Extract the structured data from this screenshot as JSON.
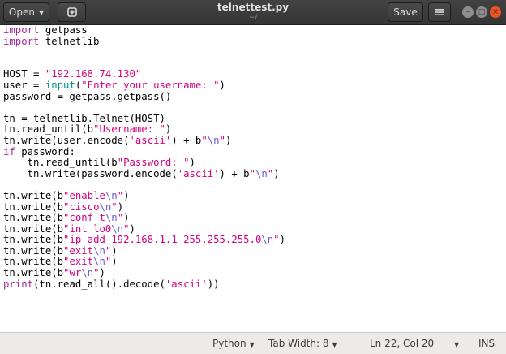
{
  "titlebar": {
    "open_label": "Open",
    "new_tab_icon": "new-tab-icon",
    "title": "telnettest.py",
    "subtitle": "~/",
    "save_label": "Save",
    "menu_icon": "hamburger-menu-icon",
    "minimize_icon": "minimize-icon",
    "maximize_icon": "maximize-icon",
    "close_icon": "close-icon"
  },
  "editor": {
    "lines": [
      [
        {
          "t": "import",
          "c": "kw"
        },
        {
          "t": " getpass"
        }
      ],
      [
        {
          "t": "import",
          "c": "kw"
        },
        {
          "t": " telnetlib"
        }
      ],
      [],
      [],
      [
        {
          "t": "HOST = "
        },
        {
          "t": "\"192.168.74.130\"",
          "c": "str"
        }
      ],
      [
        {
          "t": "user = "
        },
        {
          "t": "input",
          "c": "fn"
        },
        {
          "t": "("
        },
        {
          "t": "\"Enter your username: \"",
          "c": "str"
        },
        {
          "t": ")"
        }
      ],
      [
        {
          "t": "password = getpass.getpass()"
        }
      ],
      [],
      [
        {
          "t": "tn = telnetlib.Telnet(HOST)"
        }
      ],
      [
        {
          "t": "tn.read_until(b"
        },
        {
          "t": "\"Username: \"",
          "c": "str"
        },
        {
          "t": ")"
        }
      ],
      [
        {
          "t": "tn.write(user.encode("
        },
        {
          "t": "'ascii'",
          "c": "str"
        },
        {
          "t": ") + b"
        },
        {
          "t": "\"",
          "c": "str"
        },
        {
          "t": "\\n",
          "c": "esc"
        },
        {
          "t": "\"",
          "c": "str"
        },
        {
          "t": ")"
        }
      ],
      [
        {
          "t": "if",
          "c": "kw"
        },
        {
          "t": " password:"
        }
      ],
      [
        {
          "t": "    tn.read_until(b"
        },
        {
          "t": "\"Password: \"",
          "c": "str"
        },
        {
          "t": ")"
        }
      ],
      [
        {
          "t": "    tn.write(password.encode("
        },
        {
          "t": "'ascii'",
          "c": "str"
        },
        {
          "t": ") + b"
        },
        {
          "t": "\"",
          "c": "str"
        },
        {
          "t": "\\n",
          "c": "esc"
        },
        {
          "t": "\"",
          "c": "str"
        },
        {
          "t": ")"
        }
      ],
      [],
      [
        {
          "t": "tn.write(b"
        },
        {
          "t": "\"enable",
          "c": "str"
        },
        {
          "t": "\\n",
          "c": "esc"
        },
        {
          "t": "\"",
          "c": "str"
        },
        {
          "t": ")"
        }
      ],
      [
        {
          "t": "tn.write(b"
        },
        {
          "t": "\"cisco",
          "c": "str"
        },
        {
          "t": "\\n",
          "c": "esc"
        },
        {
          "t": "\"",
          "c": "str"
        },
        {
          "t": ")"
        }
      ],
      [
        {
          "t": "tn.write(b"
        },
        {
          "t": "\"conf t",
          "c": "str"
        },
        {
          "t": "\\n",
          "c": "esc"
        },
        {
          "t": "\"",
          "c": "str"
        },
        {
          "t": ")"
        }
      ],
      [
        {
          "t": "tn.write(b"
        },
        {
          "t": "\"int lo0",
          "c": "str"
        },
        {
          "t": "\\n",
          "c": "esc"
        },
        {
          "t": "\"",
          "c": "str"
        },
        {
          "t": ")"
        }
      ],
      [
        {
          "t": "tn.write(b"
        },
        {
          "t": "\"ip add 192.168.1.1 255.255.255.0",
          "c": "str"
        },
        {
          "t": "\\n",
          "c": "esc"
        },
        {
          "t": "\"",
          "c": "str"
        },
        {
          "t": ")"
        }
      ],
      [
        {
          "t": "tn.write(b"
        },
        {
          "t": "\"exit",
          "c": "str"
        },
        {
          "t": "\\n",
          "c": "esc"
        },
        {
          "t": "\"",
          "c": "str"
        },
        {
          "t": ")"
        }
      ],
      [
        {
          "t": "tn.write(b"
        },
        {
          "t": "\"exit",
          "c": "str"
        },
        {
          "t": "\\n",
          "c": "esc"
        },
        {
          "t": "\"",
          "c": "str"
        },
        {
          "t": ")"
        },
        {
          "cursor": true
        }
      ],
      [
        {
          "t": "tn.write(b"
        },
        {
          "t": "\"wr",
          "c": "str"
        },
        {
          "t": "\\n",
          "c": "esc"
        },
        {
          "t": "\"",
          "c": "str"
        },
        {
          "t": ")"
        }
      ],
      [
        {
          "t": "print",
          "c": "kw"
        },
        {
          "t": "(tn.read_all().decode("
        },
        {
          "t": "'ascii'",
          "c": "str"
        },
        {
          "t": "))"
        }
      ]
    ]
  },
  "statusbar": {
    "language": "Python",
    "tab_width": "Tab Width: 8",
    "position": "Ln 22, Col 20",
    "mode": "INS"
  },
  "colors": {
    "keyword": "#a52aa0",
    "string": "#d7007d",
    "escape": "#6a5acd",
    "builtin": "#008b8b",
    "close_button": "#e95420"
  }
}
